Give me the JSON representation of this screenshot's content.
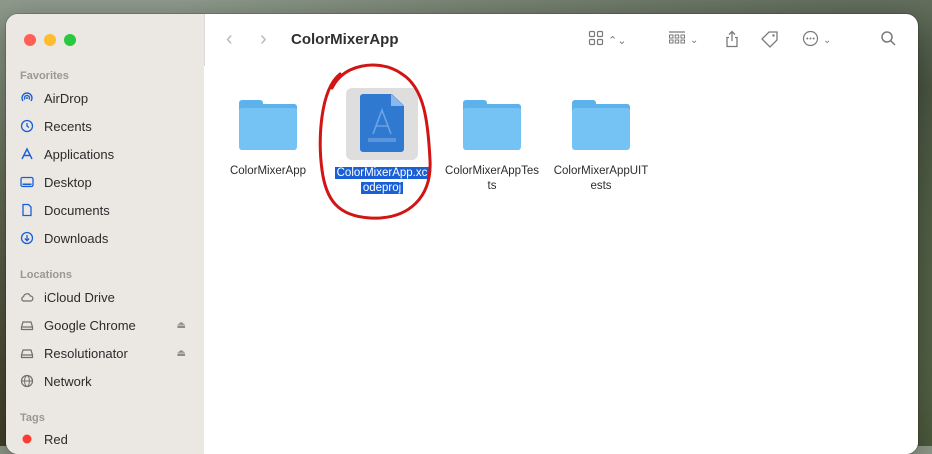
{
  "window": {
    "title": "ColorMixerApp"
  },
  "sidebar": {
    "favorites_title": "Favorites",
    "favorites": [
      {
        "label": "AirDrop",
        "icon": "airdrop-icon"
      },
      {
        "label": "Recents",
        "icon": "clock-icon"
      },
      {
        "label": "Applications",
        "icon": "applications-icon"
      },
      {
        "label": "Desktop",
        "icon": "desktop-icon"
      },
      {
        "label": "Documents",
        "icon": "document-icon"
      },
      {
        "label": "Downloads",
        "icon": "download-icon"
      }
    ],
    "locations_title": "Locations",
    "locations": [
      {
        "label": "iCloud Drive",
        "icon": "cloud-icon"
      },
      {
        "label": "Google Chrome",
        "icon": "disk-icon",
        "eject": true
      },
      {
        "label": "Resolutionator",
        "icon": "disk-icon",
        "eject": true
      },
      {
        "label": "Network",
        "icon": "globe-icon"
      }
    ],
    "tags_title": "Tags",
    "tags": [
      {
        "label": "Red",
        "color": "#ff3b30"
      }
    ]
  },
  "items": [
    {
      "label": "ColorMixerApp",
      "type": "folder"
    },
    {
      "label_line1": "ColorMixerApp.xc",
      "label_line2": "odeproj",
      "type": "xcodeproj",
      "selected": true
    },
    {
      "label_line1": "ColorMixerAppTes",
      "label_line2": "ts",
      "type": "folder"
    },
    {
      "label_line1": "ColorMixerAppUIT",
      "label_line2": "ests",
      "type": "folder"
    }
  ],
  "colors": {
    "accent": "#1a5fd6",
    "folder": "#74c3f4",
    "annotation": "#d11414"
  }
}
